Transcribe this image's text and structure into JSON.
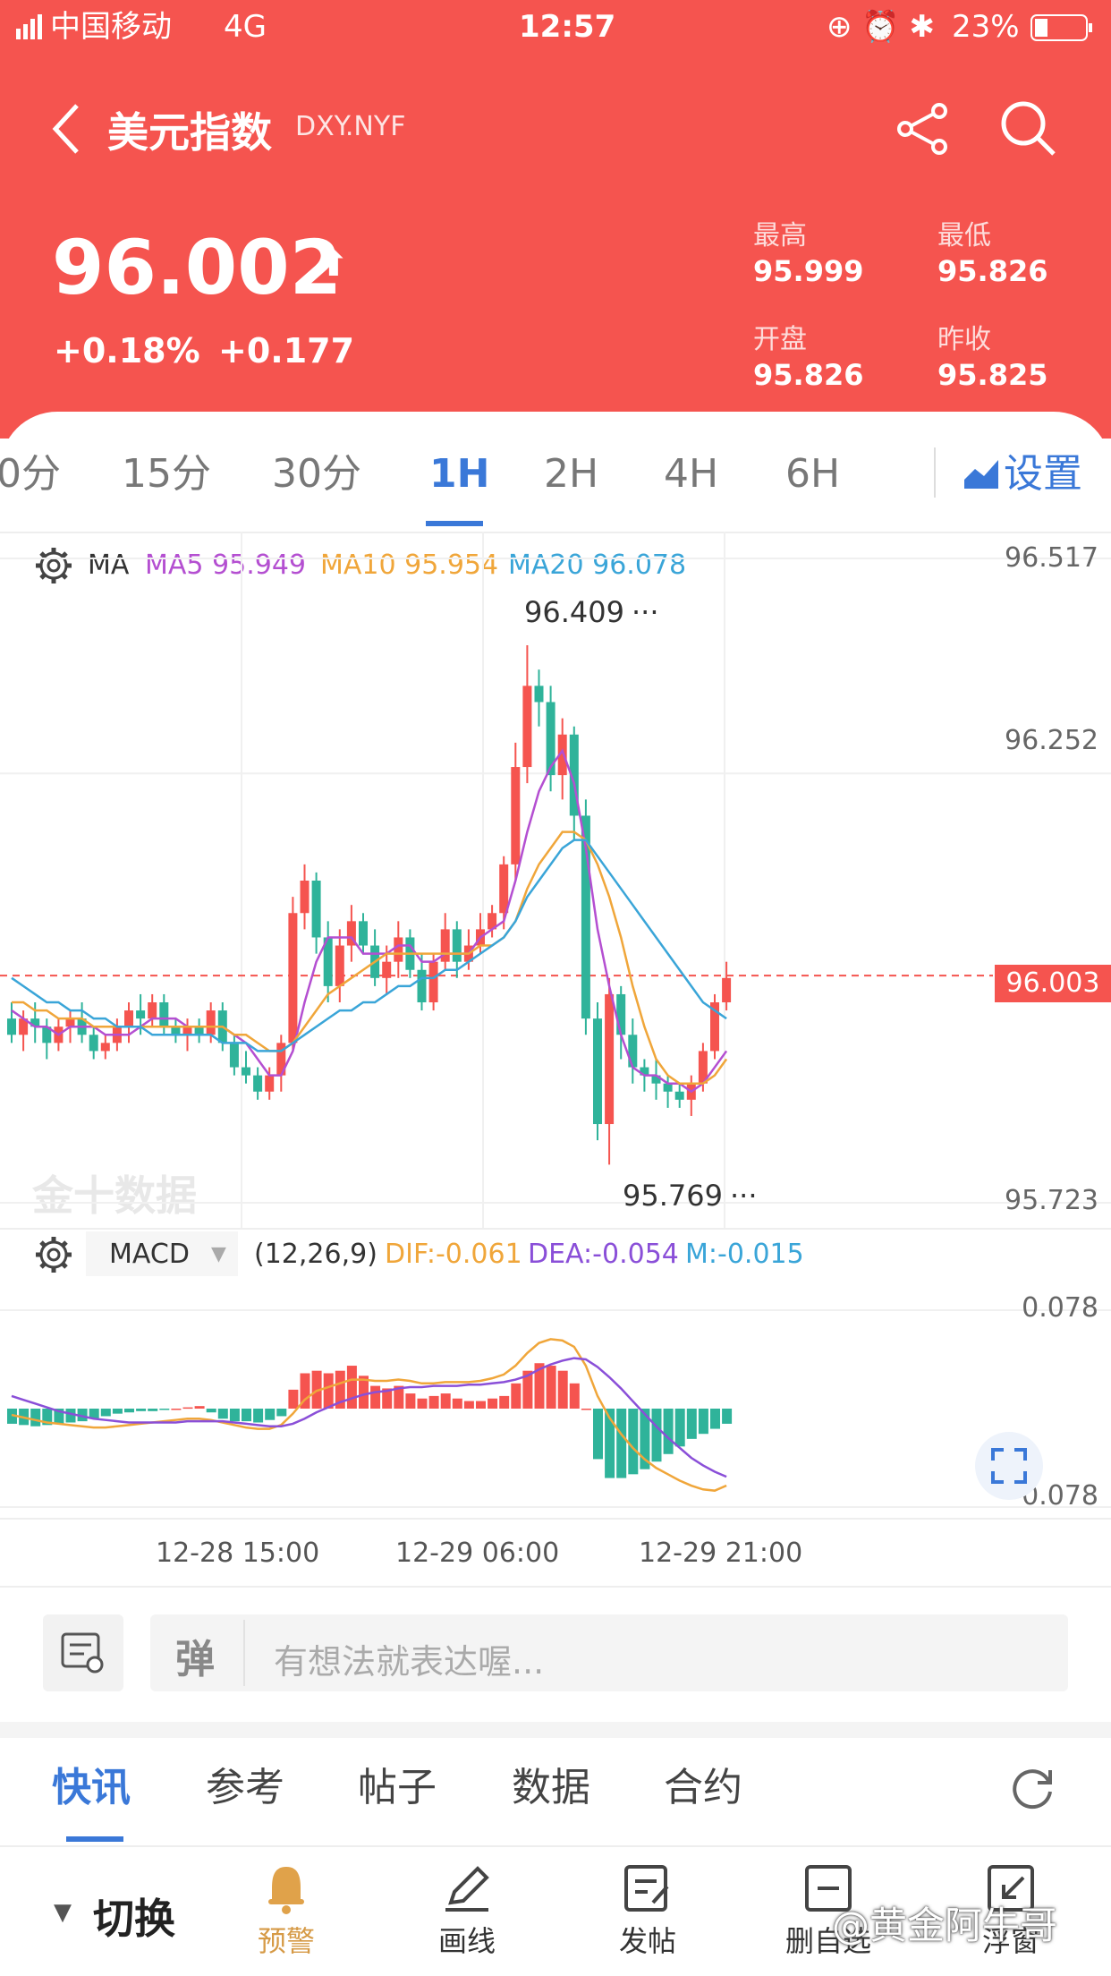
{
  "status": {
    "carrier": "中国移动",
    "network": "4G",
    "time": "12:57",
    "battery": "23%"
  },
  "header": {
    "title": "美元指数",
    "symbol": "DXY.NYF",
    "price": "96.002",
    "pct": "+0.18%",
    "change": "+0.177",
    "stats": [
      {
        "label": "最高",
        "value": "95.999"
      },
      {
        "label": "最低",
        "value": "95.826"
      },
      {
        "label": "开盘",
        "value": "95.826"
      },
      {
        "label": "昨收",
        "value": "95.825"
      }
    ]
  },
  "tabs": {
    "items": [
      "0分",
      "15分",
      "30分",
      "1H",
      "2H",
      "4H",
      "6H"
    ],
    "active": "1H",
    "settings": "设置"
  },
  "ma": {
    "label": "MA",
    "ma5": "MA5 95.949",
    "ma10": "MA10 95.954",
    "ma20": "MA20 96.078",
    "colors": {
      "ma5": "#b44fd1",
      "ma10": "#f0a63a",
      "ma20": "#3aa5d8"
    }
  },
  "macd": {
    "label": "MACD",
    "params": "(12,26,9)",
    "dif": "DIF:-0.061",
    "dea": "DEA:-0.054",
    "m": "M:-0.015"
  },
  "chart_data": [
    {
      "type": "candlestick",
      "title": "",
      "y_axis_labels": [
        "96.517",
        "96.252",
        "95.723"
      ],
      "ylim": [
        95.723,
        96.517
      ],
      "current_price": "96.003",
      "annotations": [
        "96.409",
        "95.769"
      ],
      "x_tick_labels": [
        "12-28 15:00",
        "12-29 06:00",
        "12-29 21:00"
      ],
      "watermark": "金十数据",
      "candles": [
        [
          95.95,
          95.93,
          95.97,
          95.92
        ],
        [
          95.93,
          95.95,
          95.96,
          95.91
        ],
        [
          95.95,
          95.94,
          95.97,
          95.92
        ],
        [
          95.94,
          95.92,
          95.95,
          95.9
        ],
        [
          95.92,
          95.94,
          95.95,
          95.91
        ],
        [
          95.94,
          95.95,
          95.96,
          95.92
        ],
        [
          95.95,
          95.93,
          95.97,
          95.92
        ],
        [
          95.93,
          95.91,
          95.94,
          95.9
        ],
        [
          95.91,
          95.92,
          95.93,
          95.9
        ],
        [
          95.92,
          95.94,
          95.95,
          95.91
        ],
        [
          95.94,
          95.96,
          95.97,
          95.92
        ],
        [
          95.96,
          95.95,
          95.98,
          95.93
        ],
        [
          95.95,
          95.97,
          95.98,
          95.94
        ],
        [
          95.97,
          95.94,
          95.98,
          95.93
        ],
        [
          95.94,
          95.93,
          95.95,
          95.92
        ],
        [
          95.93,
          95.94,
          95.95,
          95.91
        ],
        [
          95.94,
          95.93,
          95.95,
          95.92
        ],
        [
          95.93,
          95.96,
          95.97,
          95.92
        ],
        [
          95.96,
          95.92,
          95.97,
          95.91
        ],
        [
          95.92,
          95.89,
          95.93,
          95.88
        ],
        [
          95.89,
          95.88,
          95.91,
          95.87
        ],
        [
          95.88,
          95.86,
          95.89,
          95.85
        ],
        [
          95.86,
          95.88,
          95.89,
          95.85
        ],
        [
          95.88,
          95.92,
          95.93,
          95.86
        ],
        [
          95.92,
          96.08,
          96.1,
          95.91
        ],
        [
          96.08,
          96.12,
          96.14,
          96.06
        ],
        [
          96.12,
          96.05,
          96.13,
          96.03
        ],
        [
          96.05,
          95.99,
          96.07,
          95.97
        ],
        [
          95.99,
          96.04,
          96.06,
          95.97
        ],
        [
          96.04,
          96.07,
          96.09,
          96.02
        ],
        [
          96.07,
          96.04,
          96.08,
          96.03
        ],
        [
          96.04,
          96.0,
          96.06,
          95.99
        ],
        [
          96.0,
          96.02,
          96.04,
          95.98
        ],
        [
          96.02,
          96.05,
          96.07,
          96.0
        ],
        [
          96.05,
          96.01,
          96.06,
          96.0
        ],
        [
          96.01,
          95.97,
          96.03,
          95.96
        ],
        [
          95.97,
          96.02,
          96.03,
          95.96
        ],
        [
          96.02,
          96.06,
          96.08,
          96.01
        ],
        [
          96.06,
          96.02,
          96.07,
          96.0
        ],
        [
          96.02,
          96.04,
          96.06,
          96.01
        ],
        [
          96.04,
          96.06,
          96.08,
          96.03
        ],
        [
          96.06,
          96.08,
          96.09,
          96.05
        ],
        [
          96.08,
          96.14,
          96.15,
          96.06
        ],
        [
          96.14,
          96.26,
          96.29,
          96.12
        ],
        [
          96.26,
          96.36,
          96.41,
          96.24
        ],
        [
          96.36,
          96.34,
          96.38,
          96.31
        ],
        [
          96.34,
          96.25,
          96.36,
          96.23
        ],
        [
          96.25,
          96.3,
          96.32,
          96.22
        ],
        [
          96.3,
          96.2,
          96.31,
          96.17
        ],
        [
          96.2,
          95.95,
          96.22,
          95.93
        ],
        [
          95.95,
          95.82,
          95.97,
          95.8
        ],
        [
          95.82,
          95.98,
          96.0,
          95.77
        ],
        [
          95.98,
          95.93,
          95.99,
          95.9
        ],
        [
          95.93,
          95.89,
          95.95,
          95.87
        ],
        [
          95.89,
          95.88,
          95.9,
          95.86
        ],
        [
          95.88,
          95.87,
          95.9,
          95.85
        ],
        [
          95.87,
          95.86,
          95.88,
          95.84
        ],
        [
          95.86,
          95.85,
          95.87,
          95.84
        ],
        [
          95.85,
          95.87,
          95.88,
          95.83
        ],
        [
          95.87,
          95.91,
          95.92,
          95.86
        ],
        [
          95.91,
          95.97,
          95.98,
          95.9
        ],
        [
          95.97,
          96.0,
          96.02,
          95.96
        ]
      ],
      "series": [
        {
          "name": "MA5",
          "values": [
            95.96,
            95.95,
            95.94,
            95.94,
            95.93,
            95.94,
            95.94,
            95.94,
            95.93,
            95.93,
            95.93,
            95.94,
            95.95,
            95.95,
            95.95,
            95.94,
            95.94,
            95.94,
            95.94,
            95.93,
            95.92,
            95.9,
            95.88,
            95.88,
            95.91,
            95.97,
            96.02,
            96.05,
            96.05,
            96.05,
            96.03,
            96.03,
            96.03,
            96.04,
            96.04,
            96.02,
            96.02,
            96.03,
            96.03,
            96.03,
            96.05,
            96.06,
            96.07,
            96.12,
            96.18,
            96.23,
            96.26,
            96.28,
            96.24,
            96.16,
            96.06,
            95.99,
            95.93,
            95.89,
            95.88,
            95.88,
            95.87,
            95.87,
            95.86,
            95.87,
            95.89,
            95.91
          ]
        },
        {
          "name": "MA10",
          "values": [
            95.97,
            95.97,
            95.96,
            95.96,
            95.95,
            95.95,
            95.95,
            95.94,
            95.94,
            95.94,
            95.94,
            95.94,
            95.94,
            95.94,
            95.94,
            95.94,
            95.94,
            95.94,
            95.94,
            95.93,
            95.93,
            95.92,
            95.91,
            95.91,
            95.92,
            95.94,
            95.96,
            95.98,
            95.99,
            96.0,
            96.01,
            96.02,
            96.03,
            96.03,
            96.03,
            96.03,
            96.03,
            96.03,
            96.03,
            96.03,
            96.04,
            96.04,
            96.05,
            96.07,
            96.11,
            96.14,
            96.16,
            96.18,
            96.18,
            96.17,
            96.14,
            96.1,
            96.05,
            95.99,
            95.94,
            95.9,
            95.88,
            95.87,
            95.87,
            95.87,
            95.88,
            95.9
          ]
        },
        {
          "name": "MA20",
          "values": [
            96.0,
            95.99,
            95.98,
            95.97,
            95.97,
            95.96,
            95.96,
            95.95,
            95.95,
            95.94,
            95.94,
            95.94,
            95.93,
            95.93,
            95.93,
            95.93,
            95.93,
            95.93,
            95.92,
            95.92,
            95.92,
            95.91,
            95.91,
            95.91,
            95.92,
            95.93,
            95.94,
            95.95,
            95.96,
            95.96,
            95.97,
            95.97,
            95.98,
            95.99,
            95.99,
            96.0,
            96.0,
            96.01,
            96.01,
            96.02,
            96.03,
            96.04,
            96.05,
            96.07,
            96.1,
            96.12,
            96.14,
            96.16,
            96.17,
            96.17,
            96.15,
            96.13,
            96.11,
            96.09,
            96.07,
            96.05,
            96.03,
            96.01,
            95.99,
            95.97,
            95.96,
            95.95
          ]
        }
      ]
    },
    {
      "type": "macd",
      "y_axis_labels": [
        "0.078",
        "-0.078"
      ],
      "ylim": [
        -0.078,
        0.078
      ],
      "histogram": [
        -0.012,
        -0.013,
        -0.014,
        -0.013,
        -0.012,
        -0.011,
        -0.01,
        -0.008,
        -0.006,
        -0.004,
        -0.003,
        -0.002,
        -0.002,
        -0.001,
        0.0,
        0.001,
        0.002,
        -0.003,
        -0.008,
        -0.01,
        -0.01,
        -0.011,
        -0.009,
        -0.006,
        0.015,
        0.028,
        0.03,
        0.028,
        0.03,
        0.034,
        0.026,
        0.018,
        0.016,
        0.018,
        0.012,
        0.008,
        0.01,
        0.012,
        0.008,
        0.006,
        0.006,
        0.008,
        0.01,
        0.02,
        0.03,
        0.036,
        0.034,
        0.03,
        0.02,
        0.0,
        -0.04,
        -0.055,
        -0.055,
        -0.052,
        -0.048,
        -0.042,
        -0.036,
        -0.03,
        -0.024,
        -0.02,
        -0.016,
        -0.012
      ],
      "series": [
        {
          "name": "DIF",
          "values": [
            -0.005,
            -0.007,
            -0.009,
            -0.011,
            -0.012,
            -0.013,
            -0.014,
            -0.015,
            -0.015,
            -0.014,
            -0.013,
            -0.012,
            -0.011,
            -0.01,
            -0.009,
            -0.008,
            -0.008,
            -0.009,
            -0.011,
            -0.013,
            -0.015,
            -0.016,
            -0.016,
            -0.013,
            -0.004,
            0.007,
            0.014,
            0.017,
            0.02,
            0.023,
            0.023,
            0.022,
            0.022,
            0.023,
            0.022,
            0.02,
            0.02,
            0.021,
            0.021,
            0.021,
            0.022,
            0.024,
            0.027,
            0.034,
            0.044,
            0.052,
            0.055,
            0.054,
            0.049,
            0.034,
            0.01,
            -0.007,
            -0.02,
            -0.031,
            -0.04,
            -0.047,
            -0.052,
            -0.057,
            -0.061,
            -0.064,
            -0.065,
            -0.061
          ]
        },
        {
          "name": "DEA",
          "values": [
            0.01,
            0.007,
            0.004,
            0.001,
            -0.002,
            -0.004,
            -0.006,
            -0.008,
            -0.009,
            -0.01,
            -0.011,
            -0.011,
            -0.011,
            -0.011,
            -0.011,
            -0.01,
            -0.01,
            -0.01,
            -0.01,
            -0.011,
            -0.012,
            -0.013,
            -0.014,
            -0.014,
            -0.012,
            -0.008,
            -0.003,
            0.001,
            0.005,
            0.008,
            0.011,
            0.013,
            0.014,
            0.016,
            0.017,
            0.017,
            0.018,
            0.018,
            0.018,
            0.019,
            0.019,
            0.02,
            0.021,
            0.023,
            0.026,
            0.031,
            0.035,
            0.038,
            0.04,
            0.039,
            0.033,
            0.025,
            0.016,
            0.006,
            -0.004,
            -0.014,
            -0.023,
            -0.031,
            -0.039,
            -0.045,
            -0.05,
            -0.054
          ]
        }
      ]
    }
  ],
  "comment": {
    "placeholder": "有想法就表达喔..."
  },
  "news_tabs": [
    "快讯",
    "参考",
    "帖子",
    "数据",
    "合约"
  ],
  "bottom": {
    "switch": "切换",
    "items": [
      "预警",
      "画线",
      "发帖",
      "删自选",
      "浮窗"
    ]
  },
  "watermark": "@黄金阿牛哥"
}
